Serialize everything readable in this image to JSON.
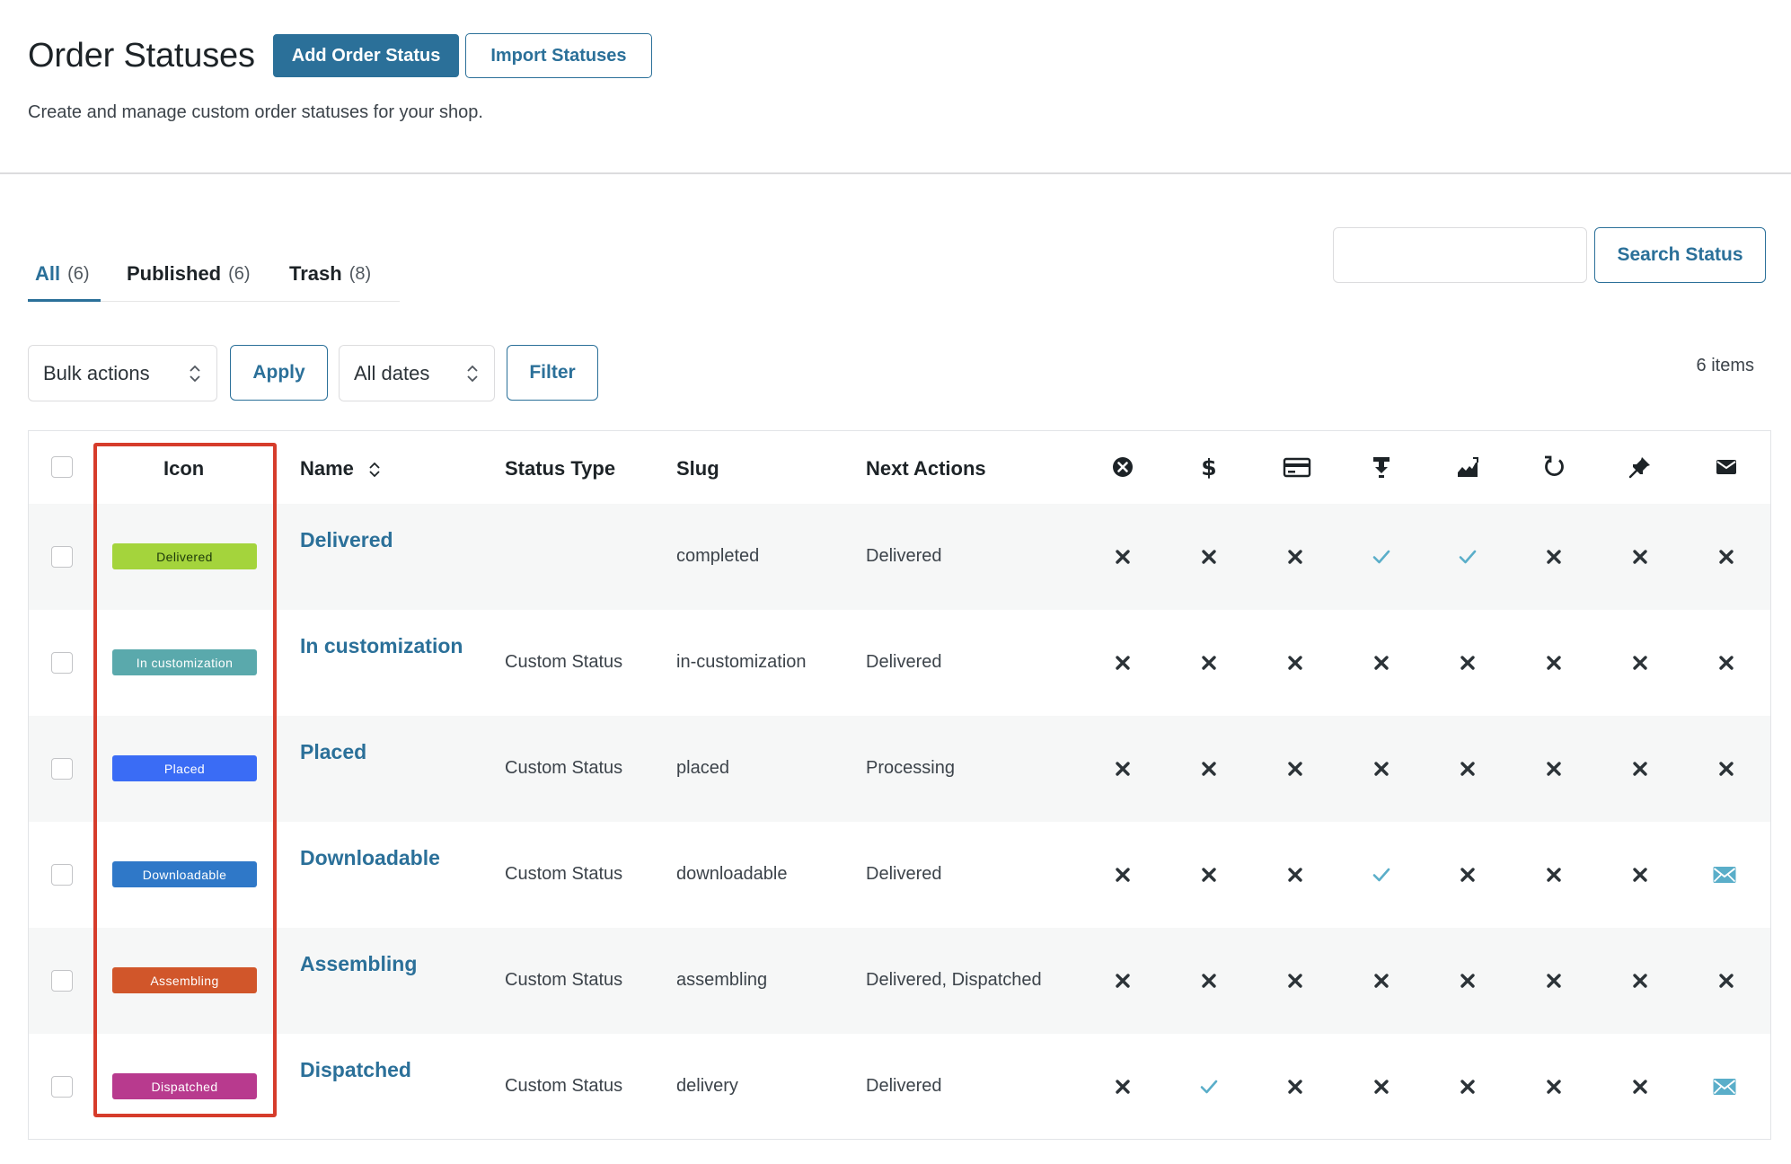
{
  "header": {
    "title": "Order Statuses",
    "add_button": "Add Order Status",
    "import_button": "Import Statuses",
    "subtitle": "Create and manage custom order statuses for your shop."
  },
  "tabs": [
    {
      "label": "All",
      "count": "(6)",
      "active": true
    },
    {
      "label": "Published",
      "count": "(6)",
      "active": false
    },
    {
      "label": "Trash",
      "count": "(8)",
      "active": false
    }
  ],
  "search": {
    "button": "Search Status",
    "value": ""
  },
  "toolbar": {
    "bulk_actions": "Bulk actions",
    "apply": "Apply",
    "dates": "All dates",
    "filter": "Filter",
    "items_count": "6 items"
  },
  "table": {
    "headers": {
      "icon": "Icon",
      "name": "Name",
      "status_type": "Status Type",
      "slug": "Slug",
      "next_actions": "Next Actions"
    },
    "flag_icons": [
      "cancel-circle-icon",
      "dollar-icon",
      "credit-card-icon",
      "download-icon",
      "chart-icon",
      "refresh-icon",
      "pin-icon",
      "email-icon"
    ],
    "rows": [
      {
        "badge": "Delivered",
        "badge_bg": "#a4d43c",
        "badge_fg": "#1d3a0a",
        "name": "Delivered",
        "type": "",
        "slug": "completed",
        "next": "Delivered",
        "flags": [
          "x",
          "x",
          "x",
          "check",
          "check",
          "x",
          "x",
          "x"
        ]
      },
      {
        "badge": "In customization",
        "badge_bg": "#5aa9ac",
        "badge_fg": "#ffffff",
        "name": "In customization",
        "type": "Custom Status",
        "slug": "in-customization",
        "next": "Delivered",
        "flags": [
          "x",
          "x",
          "x",
          "x",
          "x",
          "x",
          "x",
          "x"
        ]
      },
      {
        "badge": "Placed",
        "badge_bg": "#3a6cf5",
        "badge_fg": "#ffffff",
        "name": "Placed",
        "type": "Custom Status",
        "slug": "placed",
        "next": "Processing",
        "flags": [
          "x",
          "x",
          "x",
          "x",
          "x",
          "x",
          "x",
          "x"
        ]
      },
      {
        "badge": "Downloadable",
        "badge_bg": "#2f78c8",
        "badge_fg": "#ffffff",
        "name": "Downloadable",
        "type": "Custom Status",
        "slug": "downloadable",
        "next": "Delivered",
        "flags": [
          "x",
          "x",
          "x",
          "check",
          "x",
          "x",
          "x",
          "mail"
        ]
      },
      {
        "badge": "Assembling",
        "badge_bg": "#d1562a",
        "badge_fg": "#ffffff",
        "name": "Assembling",
        "type": "Custom Status",
        "slug": "assembling",
        "next": "Delivered, Dispatched",
        "flags": [
          "x",
          "x",
          "x",
          "x",
          "x",
          "x",
          "x",
          "x"
        ]
      },
      {
        "badge": "Dispatched",
        "badge_bg": "#b83a8e",
        "badge_fg": "#ffffff",
        "name": "Dispatched",
        "type": "Custom Status",
        "slug": "delivery",
        "next": "Delivered",
        "flags": [
          "x",
          "check",
          "x",
          "x",
          "x",
          "x",
          "x",
          "mail"
        ]
      }
    ]
  },
  "colors": {
    "accent": "#2b7099",
    "check": "#5aaec9",
    "highlight": "#d63c2b"
  }
}
